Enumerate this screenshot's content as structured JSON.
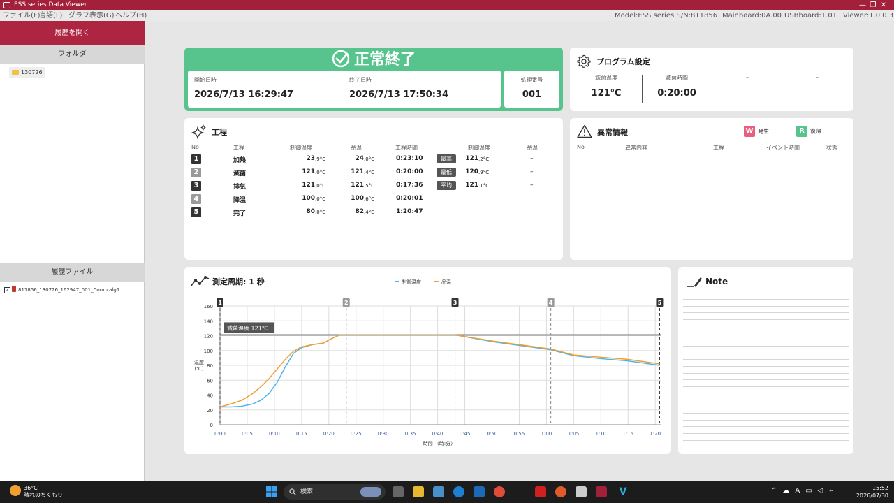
{
  "titlebar": {
    "title": "ESS series Data Viewer",
    "minimize": "—",
    "restore": "❐",
    "close": "✕"
  },
  "menu": {
    "items": [
      "ファイル(F)",
      "言語(L)",
      "グラフ表示(G)",
      "ヘルプ(H)"
    ],
    "model": "Model:ESS series S/N:811856",
    "mainboard": "Mainboard:0A.00",
    "usbboard": "USBboard:1.01",
    "viewer": "Viewer:1.0.0.3"
  },
  "sidebar": {
    "open_history": "履歴を開く",
    "folder_header": "フォルダ",
    "folder_item": "130726",
    "history_header": "履歴ファイル",
    "history_file": "811856_130726_162947_001_Comp.alg1"
  },
  "status": {
    "headline": "正常終了",
    "start_label": "開始日時",
    "start_value": "2026/7/13 16:29:47",
    "end_label": "終了日時",
    "end_value": "2026/7/13 17:50:34",
    "number_label": "処理番号",
    "number_value": "001",
    "color": "#57c48e"
  },
  "program": {
    "title": "プログラム設定",
    "columns": [
      {
        "label": "滅菌温度",
        "value": "121℃"
      },
      {
        "label": "滅菌時間",
        "value": "0:20:00"
      },
      {
        "label": "–",
        "value": "–"
      },
      {
        "label": "–",
        "value": "–"
      }
    ]
  },
  "process": {
    "title": "工程",
    "headers": {
      "no": "No",
      "step": "工程",
      "ctrl_temp": "制御温度",
      "prod_temp": "品温",
      "time": "工程時間",
      "ctrl_temp2": "制御温度",
      "prod_temp2": "品温"
    },
    "rows": [
      {
        "no": "1",
        "name": "加熱",
        "ctrl_int": "23",
        "ctrl_dec": ".9",
        "prod_int": "24",
        "prod_dec": ".0",
        "time": "0:23:10",
        "color": "#333333"
      },
      {
        "no": "2",
        "name": "滅菌",
        "ctrl_int": "121",
        "ctrl_dec": ".0",
        "prod_int": "121",
        "prod_dec": ".4",
        "time": "0:20:00",
        "color": "#9a9a9a"
      },
      {
        "no": "3",
        "name": "排気",
        "ctrl_int": "121",
        "ctrl_dec": ".0",
        "prod_int": "121",
        "prod_dec": ".5",
        "time": "0:17:36",
        "color": "#333333"
      },
      {
        "no": "4",
        "name": "降温",
        "ctrl_int": "100",
        "ctrl_dec": ".0",
        "prod_int": "100",
        "prod_dec": ".6",
        "time": "0:20:01",
        "color": "#9a9a9a"
      },
      {
        "no": "5",
        "name": "完了",
        "ctrl_int": "80",
        "ctrl_dec": ".0",
        "prod_int": "82",
        "prod_dec": ".4",
        "time": "1:20:47",
        "color": "#333333"
      }
    ],
    "unit": "°C",
    "stats": [
      {
        "label": "最高",
        "ctrl_int": "121",
        "ctrl_dec": ".2",
        "prod": "–"
      },
      {
        "label": "最低",
        "ctrl_int": "120",
        "ctrl_dec": ".9",
        "prod": "–"
      },
      {
        "label": "平均",
        "ctrl_int": "121",
        "ctrl_dec": ".1",
        "prod": "–"
      }
    ]
  },
  "alarm": {
    "title": "異常情報",
    "legend_w": "W",
    "legend_w_label": "発生",
    "legend_r": "R",
    "legend_r_label": "復帰",
    "headers": {
      "no": "No",
      "content": "異常内容",
      "step": "工程",
      "event_time": "イベント時間",
      "state": "状態"
    }
  },
  "chart": {
    "title": "測定周期: 1 秒",
    "ylabel_line1": "温度",
    "ylabel_line2": "(℃)",
    "xlabel": "時間 （時:分）",
    "annotation": "滅菌温度 121℃"
  },
  "chart_data": {
    "type": "line",
    "ylim": [
      0,
      160
    ],
    "yticks": [
      0,
      20,
      40,
      60,
      80,
      100,
      120,
      140,
      160
    ],
    "xlim_min": [
      0,
      81
    ],
    "xtick_labels": [
      "0:00",
      "0:05",
      "0:10",
      "0:15",
      "0:20",
      "0:25",
      "0:30",
      "0:35",
      "0:40",
      "0:45",
      "0:50",
      "0:55",
      "1:00",
      "1:05",
      "1:10",
      "1:15",
      "1:20"
    ],
    "xtick_minutes": [
      0,
      5,
      10,
      15,
      20,
      25,
      30,
      35,
      40,
      45,
      50,
      55,
      60,
      65,
      70,
      75,
      80
    ],
    "reference_line": 121,
    "step_markers": [
      {
        "label": "1",
        "minute": 0
      },
      {
        "label": "2",
        "minute": 23.2
      },
      {
        "label": "3",
        "minute": 43.2
      },
      {
        "label": "4",
        "minute": 60.8
      },
      {
        "label": "5",
        "minute": 80.8
      }
    ],
    "grid": true,
    "legend_position": "top-center",
    "series": [
      {
        "name": "制御温度",
        "color": "#4fb3e8",
        "x": [
          0,
          2,
          4,
          6,
          7.5,
          9,
          10.5,
          12,
          13.5,
          15,
          17,
          19,
          20.5,
          22,
          23.2,
          30,
          40,
          43.2,
          50,
          60.8,
          65,
          70,
          75,
          80.8
        ],
        "y": [
          24,
          24,
          25,
          28,
          33,
          42,
          57,
          78,
          96,
          104,
          108,
          110,
          116,
          121,
          121,
          121,
          121,
          121,
          112,
          101,
          93,
          89,
          86,
          80
        ]
      },
      {
        "name": "品温",
        "color": "#f0a030",
        "x": [
          0,
          2,
          4,
          6,
          7.5,
          9,
          10.5,
          12,
          13.5,
          15,
          17,
          19,
          20.5,
          22,
          23.2,
          30,
          40,
          43.2,
          50,
          60.8,
          65,
          70,
          75,
          80.8
        ],
        "y": [
          24,
          28,
          33,
          42,
          51,
          62,
          75,
          88,
          99,
          105,
          108,
          110,
          116,
          121,
          121,
          121,
          121,
          121,
          113,
          102,
          94,
          91,
          88,
          82
        ]
      }
    ]
  },
  "note": {
    "title": "Note"
  },
  "taskbar": {
    "temp": "36°C",
    "weather": "晴れのちくもり",
    "search": "検索",
    "time": "15:52",
    "date": "2026/07/30"
  }
}
